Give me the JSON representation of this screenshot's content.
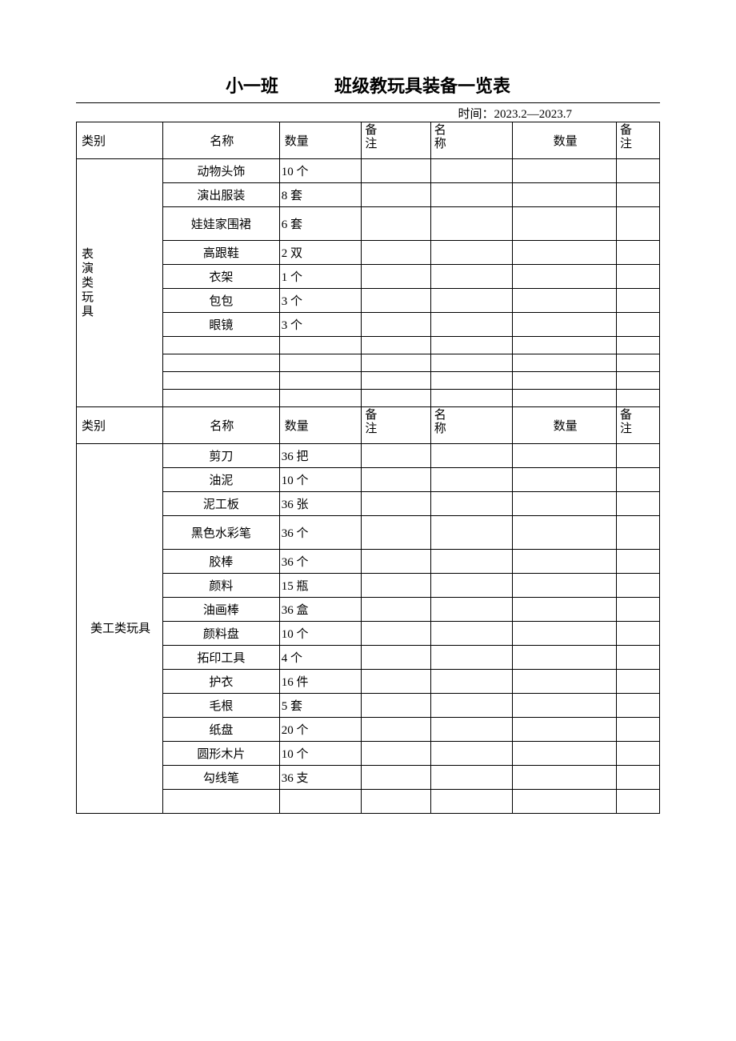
{
  "title": {
    "class_name": "小一班",
    "heading": "班级教玩具装备一览表"
  },
  "subtitle": "时间：2023.2—2023.7",
  "headers": {
    "category": "类别",
    "name": "名称",
    "quantity": "数量",
    "note": "备注",
    "name2": "名称",
    "quantity2": "数量",
    "note2": "备注"
  },
  "note_vertical": {
    "l1": "备",
    "l2": "注"
  },
  "name_vertical": {
    "l1": "名",
    "l2": "称"
  },
  "section1": {
    "category": "表演类玩具",
    "rows": [
      {
        "name": "动物头饰",
        "qty": "10 个"
      },
      {
        "name": "演出服装",
        "qty": "8 套"
      },
      {
        "name": "娃娃家围裙",
        "qty": "6 套"
      },
      {
        "name": "高跟鞋",
        "qty": "2 双"
      },
      {
        "name": "衣架",
        "qty": "1 个"
      },
      {
        "name": "包包",
        "qty": "3 个"
      },
      {
        "name": "眼镜",
        "qty": "3 个"
      },
      {
        "name": "",
        "qty": ""
      },
      {
        "name": "",
        "qty": ""
      },
      {
        "name": "",
        "qty": ""
      },
      {
        "name": "",
        "qty": ""
      }
    ]
  },
  "section2": {
    "category": "美工类玩具",
    "rows": [
      {
        "name": "剪刀",
        "qty": "36 把"
      },
      {
        "name": "油泥",
        "qty": "10 个"
      },
      {
        "name": "泥工板",
        "qty": "36 张"
      },
      {
        "name": "黑色水彩笔",
        "qty": "36 个"
      },
      {
        "name": "胶棒",
        "qty": "36 个"
      },
      {
        "name": "颜料",
        "qty": "15 瓶"
      },
      {
        "name": "油画棒",
        "qty": "36 盒"
      },
      {
        "name": "颜料盘",
        "qty": "10 个"
      },
      {
        "name": "拓印工具",
        "qty": "4 个"
      },
      {
        "name": "护衣",
        "qty": "16 件"
      },
      {
        "name": "毛根",
        "qty": "5 套"
      },
      {
        "name": "纸盘",
        "qty": "20 个"
      },
      {
        "name": "圆形木片",
        "qty": "10 个"
      },
      {
        "name": "勾线笔",
        "qty": "36 支"
      },
      {
        "name": "",
        "qty": ""
      }
    ]
  }
}
